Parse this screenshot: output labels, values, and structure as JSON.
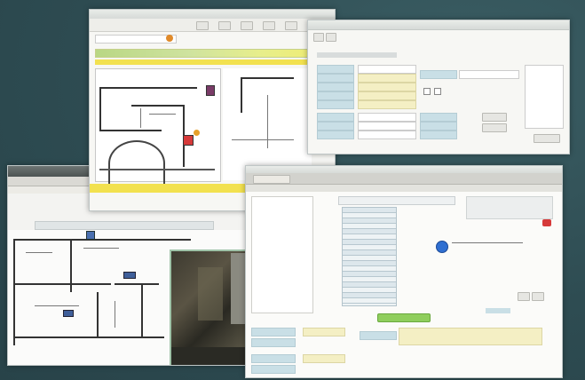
{
  "scene": "collage-of-floorplan-security-software-windows",
  "colors": {
    "background": "#2f4f55",
    "yellow_highlight": "#f2e14f",
    "green_bar": "#b9d784",
    "field_yellow": "#f4efc4",
    "label_blue": "#c9dfe6",
    "marker_red": "#d63a3a",
    "marker_blue": "#2f6fd1",
    "ok_green": "#8fce5d"
  },
  "icons": {
    "alarm": "alarm-marker-icon",
    "camera": "camera-marker-icon",
    "status": "status-dot-icon"
  }
}
